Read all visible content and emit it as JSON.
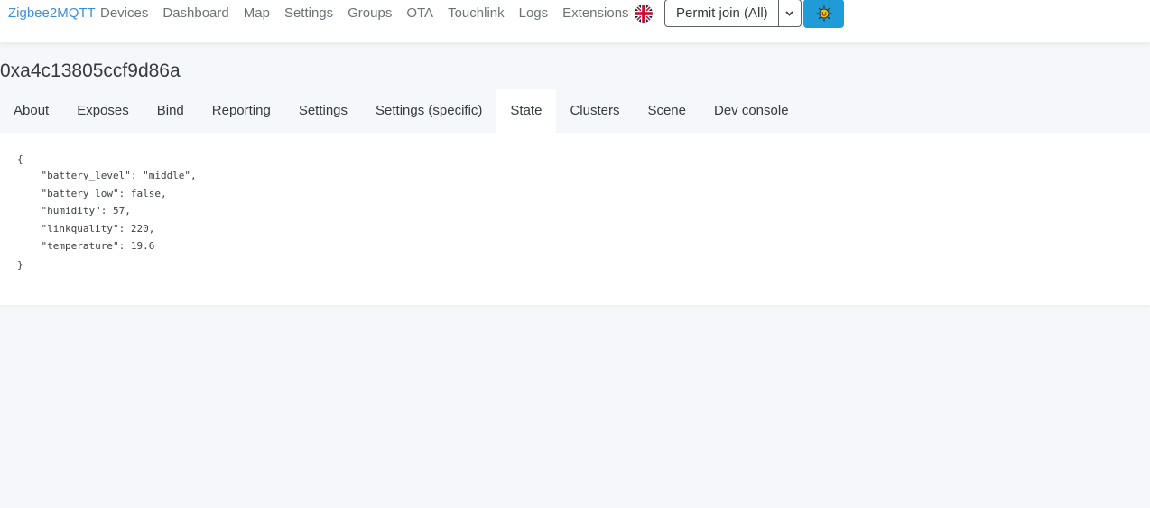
{
  "navbar": {
    "brand": "Zigbee2MQTT",
    "links": [
      "Devices",
      "Dashboard",
      "Map",
      "Settings",
      "Groups",
      "OTA",
      "Touchlink",
      "Logs",
      "Extensions"
    ],
    "language_icon": "uk-flag-icon",
    "permit_join_label": "Permit join (All)",
    "permit_caret_icon": "chevron-down-icon",
    "theme_icon": "sun-icon",
    "theme_button_color": "#1f9bd8"
  },
  "device": {
    "title": "0xa4c13805ccf9d86a"
  },
  "tabs": {
    "items": [
      "About",
      "Exposes",
      "Bind",
      "Reporting",
      "Settings",
      "Settings (specific)",
      "State",
      "Clusters",
      "Scene",
      "Dev console"
    ],
    "active": "State"
  },
  "state_json": {
    "lines": [
      "{",
      "    \"battery_level\": \"middle\",",
      "    \"battery_low\": false,",
      "    \"humidity\": 57,",
      "    \"linkquality\": 220,",
      "    \"temperature\": 19.6",
      "}"
    ]
  }
}
